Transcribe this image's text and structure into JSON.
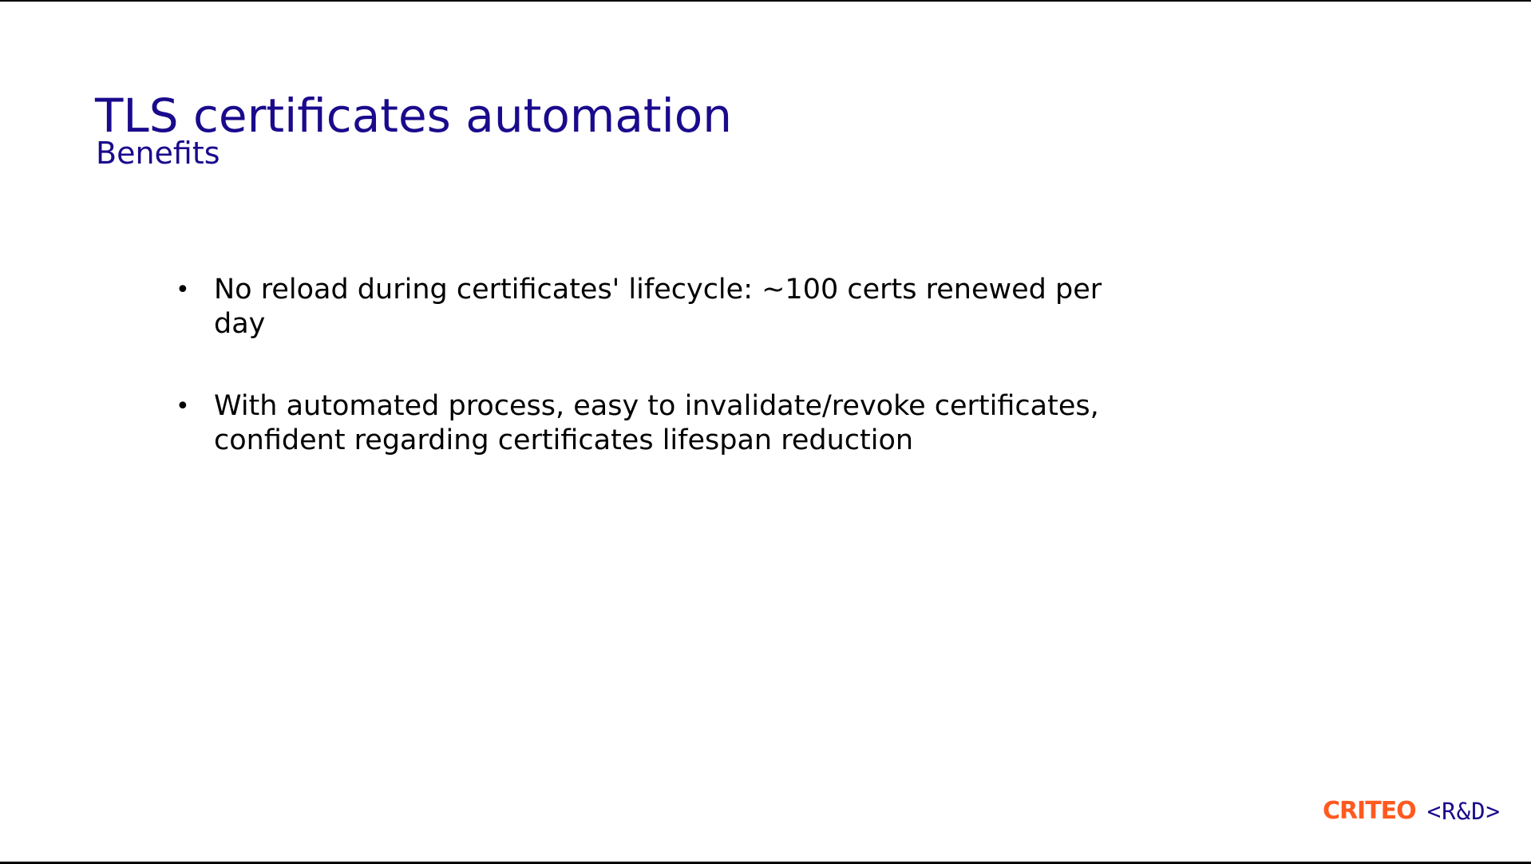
{
  "slide": {
    "title": "TLS certificates automation",
    "subtitle": "Benefits",
    "bullets": [
      "No reload during certificates' lifecycle: ~100 certs renewed per day",
      "With automated process, easy to invalidate/revoke certificates, confident regarding certificates lifespan reduction"
    ],
    "bullet_symbol": "•"
  },
  "logo": {
    "brand": "CRITEO",
    "suffix": "<R&D>"
  },
  "colors": {
    "title": "#1a0a8c",
    "text": "#000000",
    "brand": "#ff5a1f",
    "background": "#ffffff"
  }
}
